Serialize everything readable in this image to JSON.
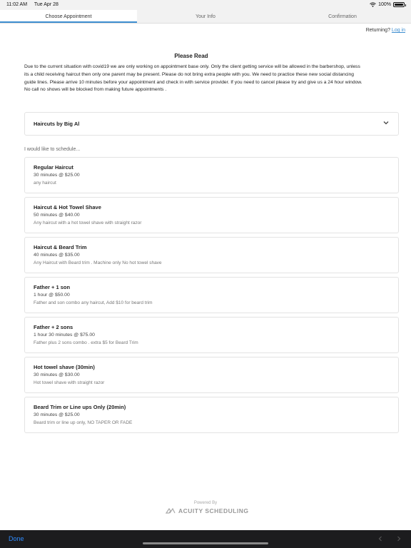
{
  "status_bar": {
    "time": "11:02 AM",
    "date": "Tue Apr 28",
    "battery": "100%",
    "battery_level": 1.0,
    "wifi_icon": "wifi-icon"
  },
  "tabs": [
    {
      "label": "Choose Appointment",
      "active": true
    },
    {
      "label": "Your Info",
      "active": false
    },
    {
      "label": "Confirmation",
      "active": false
    }
  ],
  "returning": {
    "prompt": "Returning?",
    "link": "Log in"
  },
  "notice": {
    "title": "Please Read",
    "body": "Due to the current situation with covid19 we are only working on appointment base only. Only the client getting service will be allowed in the barbershop, unless its a child receiving haircut then only one parent may be present. Please do not bring extra people with you. We need to practice these new social distancing guide lines. Please arrive 10 minutes before your appointment and check in with service provider. If you need to cancel please try and give us a 24 hour window. No call no shows will be blocked from making future appointments ."
  },
  "calendar": {
    "selected": "Haircuts by Big Al",
    "icon": "chevron-down-icon"
  },
  "schedule_label": "I would like to schedule...",
  "appointments": [
    {
      "name": "Regular Haircut",
      "price": "30 minutes @ $25.00",
      "desc": "any haircut"
    },
    {
      "name": "Haircut & Hot Towel Shave",
      "price": "50 minutes @ $40.00",
      "desc": "Any haircut with a hot towel shave with straight razor"
    },
    {
      "name": "Haircut & Beard Trim",
      "price": "40 minutes @ $35.00",
      "desc": "Any Haircut with Beard trim . Machine only No hot towel shave"
    },
    {
      "name": "Father + 1 son",
      "price": "1 hour @ $50.00",
      "desc": "Father and son combo any haircut, Add $10 for beard trim"
    },
    {
      "name": "Father + 2 sons",
      "price": "1 hour 30 minutes @ $75.00",
      "desc": "Father plus 2 sons combo . extra $5 for Beard Trim"
    },
    {
      "name": "Hot towel shave (30min)",
      "price": "30 minutes @ $30.00",
      "desc": "Hot towel shave with straight razor"
    },
    {
      "name": "Beard Trim or Line ups Only (20min)",
      "price": "30 minutes @ $25.00",
      "desc": "Beard trim or line up only, NO TAPER OR FADE"
    }
  ],
  "footer": {
    "powered_by": "Powered By",
    "brand": "ACUITY SCHEDULING",
    "logo_icon": "acuity-logo-icon"
  },
  "bottom_bar": {
    "done": "Done"
  },
  "colors": {
    "accent": "#3e8ed0",
    "done_blue": "#2f8cff",
    "bottom_bar": "#1c1c1e"
  }
}
